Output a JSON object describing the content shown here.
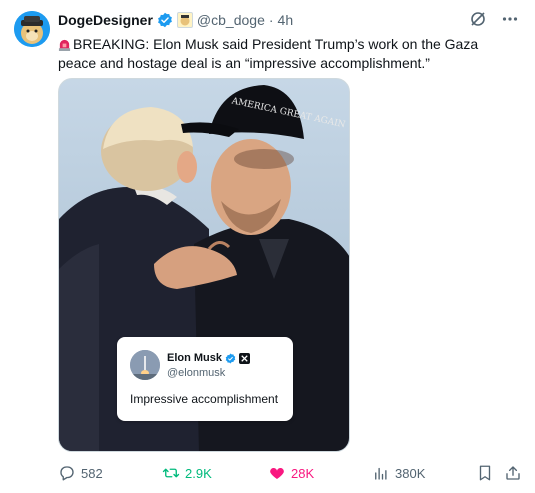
{
  "author": {
    "name": "DogeDesigner",
    "handle": "@cb_doge",
    "separator": "·",
    "time": "4h"
  },
  "tweet": {
    "text": "BREAKING: Elon Musk said President Trump’s work on the Gaza peace and hostage deal is an “impressive accomplishment.”"
  },
  "media": {
    "cap_text": "AMERICA GREAT AGAIN",
    "quote": {
      "name": "Elon Musk",
      "handle": "@elonmusk",
      "text": "Impressive accomplishment"
    }
  },
  "actions": {
    "replies": "582",
    "reposts": "2.9K",
    "likes": "28K",
    "views": "380K"
  },
  "colors": {
    "verified": "#1d9bf0",
    "repost": "#00ba7c",
    "like": "#f91880",
    "muted": "#536471"
  }
}
